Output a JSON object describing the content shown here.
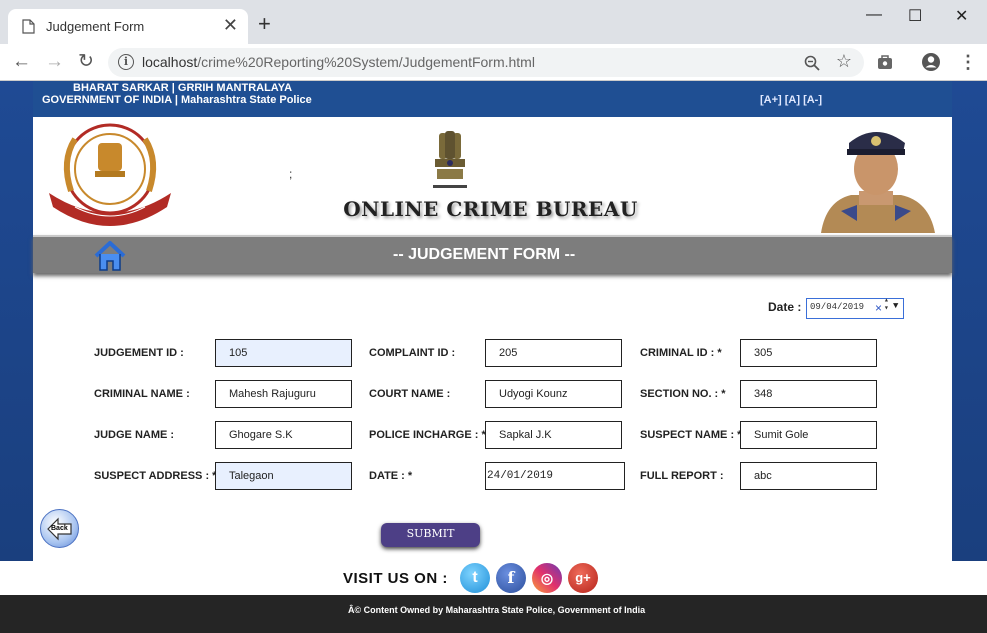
{
  "browser": {
    "tab_title": "Judgement Form",
    "tab_close": "✕",
    "new_tab": "+",
    "url_host": "localhost",
    "url_path": "/crime%20Reporting%20System/JudgementForm.html",
    "window_controls": [
      "—",
      "☐",
      "✕"
    ]
  },
  "govbar": {
    "line1": "BHARAT SARKAR  |  GRRIH MANTRALAYA",
    "line2": "GOVERNMENT OF INDIA  |  Maharashtra State Police",
    "font_controls": "[A+] [A] [A-]"
  },
  "header": {
    "semicolon": ";",
    "site_title": "ONLINE CRIME BUREAU"
  },
  "formbar": {
    "title": "-- JUDGEMENT FORM --"
  },
  "date": {
    "label": "Date :",
    "value": "09/04/2019"
  },
  "form": {
    "judgement_id": {
      "label": "JUDGEMENT ID :",
      "value": "105"
    },
    "complaint_id": {
      "label": "COMPLAINT ID :",
      "value": "205"
    },
    "criminal_id": {
      "label": "CRIMINAL ID : *",
      "value": "305"
    },
    "criminal_name": {
      "label": "CRIMINAL NAME :",
      "value": "Mahesh Rajuguru"
    },
    "court_name": {
      "label": "COURT NAME :",
      "value": "Udyogi Kounz"
    },
    "section_no": {
      "label": "SECTION NO. : *",
      "value": "348"
    },
    "judge_name": {
      "label": "JUDGE NAME :",
      "value": "Ghogare S.K"
    },
    "police_incharge": {
      "label": "POLICE INCHARGE : *",
      "value": "Sapkal J.K"
    },
    "suspect_name": {
      "label": "SUSPECT NAME : *",
      "value": "Sumit Gole"
    },
    "suspect_address": {
      "label": "SUSPECT ADDRESS : *",
      "value": "Talegaon"
    },
    "date_field": {
      "label": "DATE : *",
      "value": "24/01/2019"
    },
    "full_report": {
      "label": "FULL REPORT :",
      "value": "abc"
    }
  },
  "buttons": {
    "submit": "SUBMIT",
    "back": "Back"
  },
  "social": {
    "visit_label": "VISIT US ON :",
    "icons": [
      "twitter-icon",
      "facebook-icon",
      "instagram-icon",
      "google-plus-icon"
    ]
  },
  "footer": {
    "copyright": "Â© Content Owned by Maharashtra State Police, Government of India"
  },
  "colors": {
    "gov_bar": "#1f4f93",
    "form_bar": "#7d7d7d",
    "submit": "#4d3f86",
    "footer": "#252525",
    "autofill": "#e8f0fe"
  }
}
